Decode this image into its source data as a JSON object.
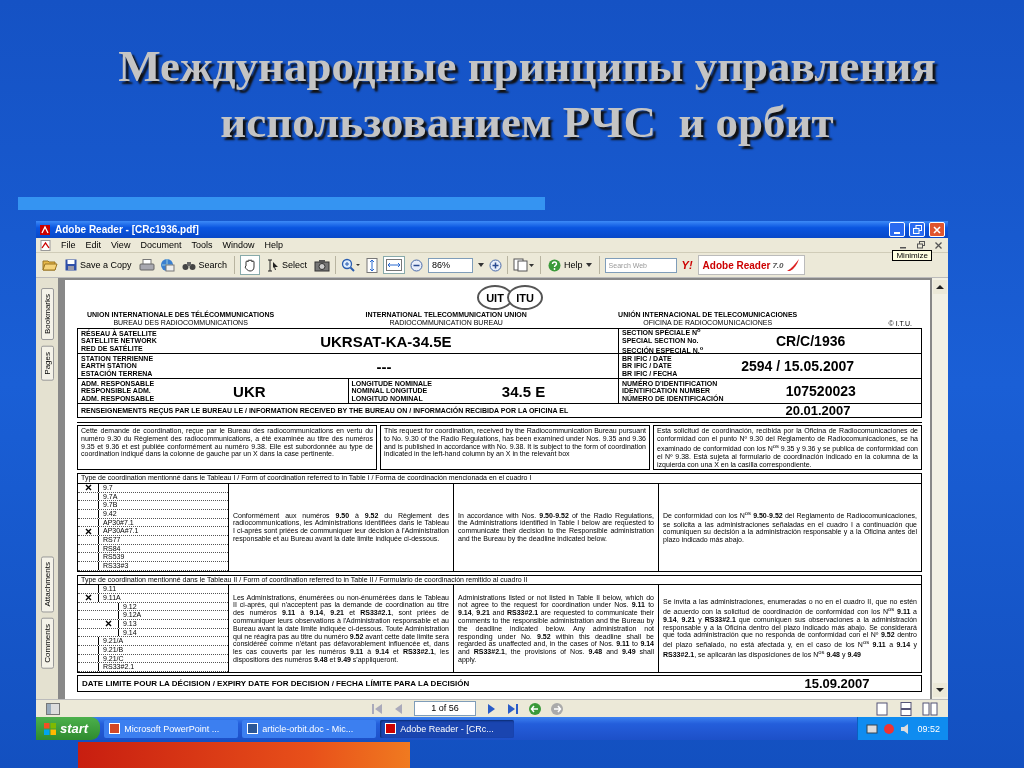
{
  "slide": {
    "title_lines": [
      "Международные принципы управления",
      "использованием РЧС  и орбит"
    ]
  },
  "window": {
    "title": "Adobe Reader - [CRc1936.pdf]",
    "tooltip": "Minimize"
  },
  "menu": [
    "File",
    "Edit",
    "View",
    "Document",
    "Tools",
    "Window",
    "Help"
  ],
  "toolbar": {
    "save_label": "Save a Copy",
    "search_label": "Search",
    "select_label": "Select",
    "zoom": "86%",
    "help_label": "Help",
    "search_web_placeholder": "Search Web",
    "yahoo": "Y!",
    "brand": "Adobe Reader",
    "version": "7.0"
  },
  "side_tabs": [
    {
      "label": "Bookmarks"
    },
    {
      "label": "Pages"
    },
    {
      "label": "Attachments"
    },
    {
      "label": "Comments"
    }
  ],
  "document": {
    "logo": [
      "UIT",
      "ITU"
    ],
    "orgs": [
      {
        "line1": "UNION INTERNATIONALE DES TÉLÉCOMMUNICATIONS",
        "line2": "BUREAU DES RADIOCOMMUNICATIONS"
      },
      {
        "line1": "INTERNATIONAL TELECOMMUNICATION UNION",
        "line2": "RADIOCOMMUNICATION BUREAU"
      },
      {
        "line1": "UNIÓN INTERNACIONAL DE TELECOMUNICACIONES",
        "line2": "OFICINA DE RADIOCOMUNICACIONES"
      }
    ],
    "copyright": "© I.T.U.",
    "network_rows": [
      {
        "cells": [
          {
            "labels": [
              "RÉSEAU À SATELLITE",
              "SATELLITE NETWORK",
              "RED DE SATÉLITE"
            ],
            "value": "UKRSAT-KA-34.5E"
          }
        ]
      },
      {
        "cells": [
          {
            "labels": [
              "STATION TERRIENNE",
              "EARTH STATION",
              "ESTACIÓN TERRENA"
            ],
            "value": "---"
          }
        ]
      },
      {
        "cells": [
          {
            "labels": [
              "ADM. RESPONSABLE",
              "RESPONSIBLE ADM.",
              "ADM. RESPONSABLE"
            ],
            "value": "UKR"
          },
          {
            "labels": [
              "LONGITUDE NOMINALE",
              "NOMINAL LONGITUDE",
              "LONGITUD NOMINAL"
            ],
            "value": "34.5 E"
          }
        ]
      }
    ],
    "reference_rows": [
      {
        "labels": [
          "SECTION SPÉCIALE N$^{o}$",
          "SPECIAL SECTION No.",
          "SECCIÓN ESPECIAL N.$^{o}$"
        ],
        "value": "CR/C/1936"
      },
      {
        "labels": [
          "BR IFIC / DATE",
          "BR IFIC / DATE",
          "BR IFIC / FECHA"
        ],
        "value": "2594 / 15.05.2007"
      },
      {
        "labels": [
          "NUMÉRO D'IDENTIFICATION",
          "IDENTIFICATION NUMBER",
          "NÚMERO DE IDENTIFICACIÓN"
        ],
        "value": "107520023"
      }
    ],
    "received": {
      "label": "RENSEIGNEMENTS REÇUS PAR LE BUREAU LE / INFORMATION RECEIVED BY THE BUREAU ON / INFORMACIÓN RECIBIDA POR LA OFICINA EL",
      "value": "20.01.2007"
    },
    "intro": [
      "Cette demande de coordination, reçue par le Bureau des radiocommunications en vertu du numéro 9.30 du Règlement des radiocommunications, a été examinée au titre des numéros 9.35 et 9.36 et est publiée conformément au numéro 9.38. Elle est subordonnée au type de coordination indiqué dans la colonne de gauche par un X dans la case pertinente.",
      "This request for coordination, received by the Radiocommunication Bureau pursuant to No. 9.30 of the Radio Regulations, has been examined under Nos. 9.35 and 9.36 and is published in accordance with No. 9.38. It is subject to the form of coordination indicated in the left-hand column by an X in the relevant box",
      "Esta solicitud de coordinación, recibida por la Oficina de Radiocomunicaciones de conformidad con el punto Nº 9.30 del Reglamento de Radiocomunicaciones, se ha examinado de conformidad con los N$^{os}$ 9.35 y 9.36 y se publica de conformidad con el Nº 9.38. Está sujeta al formulario de coordinación indicado en la columna de la izquierda con una X en la casilla correspondiente."
    ],
    "sections": [
      {
        "heading": "Type de coordination mentionné dans le Tableau I / Form of coordination referred to in Table I / Forma de coordinación mencionada en el cuadro I",
        "items": [
          {
            "label": "9.7",
            "checked": true
          },
          {
            "label": "9.7A",
            "checked": false
          },
          {
            "label": "9.7B",
            "checked": false
          },
          {
            "label": "9.42",
            "checked": false
          },
          {
            "label": "AP30#7.1",
            "checked": false
          },
          {
            "label": "AP30A#7.1",
            "checked": true
          },
          {
            "label": "RS77",
            "checked": false
          },
          {
            "label": "RS84",
            "checked": false
          },
          {
            "label": "RS539",
            "checked": false
          },
          {
            "label": "RS33#3",
            "checked": false
          }
        ],
        "texts": [
          "Conformément aux numéros **9.50** à **9.52** du Règlement des radiocommunications, les Administrations identifiées dans le Tableau I ci-après sont priées de communiquer leur décision à l'Administration responsable et au Bureau avant la date limite indiquée ci-dessous.",
          "In accordance with Nos. **9.50**-**9.52** of the Radio Regulations, the Administrations identified in Table I below are requested to communicate their decision to the Responsible administration and the Bureau by the deadline indicated below.",
          "De conformidad con los N$^{os}$ **9.50**-**9.52** del Reglamento de Radiocomunicaciones, se solicita a las administraciones señaladas en el cuadro I a continuación que comuniquen su decisión a la administración responsable y a la Oficina antes del plazo indicado más abajo."
        ]
      },
      {
        "heading": "Type de coordination mentionné dans le Tableau II / Form of coordination referred to in Table II / Formulario de coordinación remitido al cuadro II",
        "items": [
          {
            "label": "9.11",
            "checked": false
          },
          {
            "label": "9.11A",
            "checked": true,
            "children": [
              {
                "label": "9.12",
                "checked": false
              },
              {
                "label": "9.12A",
                "checked": false
              },
              {
                "label": "9.13",
                "checked": true
              },
              {
                "label": "9.14",
                "checked": false
              }
            ]
          },
          {
            "label": "9.21/A",
            "checked": false
          },
          {
            "label": "9.21/B",
            "checked": false
          },
          {
            "label": "9.21/C",
            "checked": false
          },
          {
            "label": "RS33#2.1",
            "checked": false
          }
        ],
        "texts": [
          "Les Administrations, énumérées ou non-énumérées dans le Tableau II ci-après, qui n'acceptent pas la demande de coordination au titre des numéros **9.11** à **9.14**, **9.21** et **RS33#2.1**, sont priées de communiquer leurs observations à l'Administration responsable et au Bureau avant la date limite indiquée ci-dessous. Toute Administration qui ne réagira pas au titre du numéro **9.52** avant cette date limite sera considérée comme n'étant pas défavorablement influencée et, dans les cas couverts par les numéros **9.11** à **9.14** et **RS33#2.1**, les dispositions des numéros **9.48** et **9.49** s'appliqueront.",
          "Administrations listed or not listed in Table II below, which do not agree to the request for coordination under Nos. **9.11** to **9.14**, **9.21** and **RS33#2.1** are requested to communicate their comments to the responsible administration and the Bureau by the deadline indicated below. Any administration not responding under No. **9.52** within this deadline shall be regarded as unaffected and, in the cases of Nos. **9.11** to **9.14** and **RS33#2.1**, the provisions of Nos. **9.48** and **9.49** shall apply.",
          "Se invita a las administraciones, enumeradas o no en el cuadro II, que no estén de acuerdo con la solicitud de coordinación de conformidad con los N$^{os}$ **9.11** a **9.14**, **9.21** y **RS33#2.1** que comuniquen sus observaciones a la administración responsable y a la Oficina dentro del plazo indicado más abajo. Se considerará que toda administración que no responda de conformidad con el Nº **9.52** dentro del plazo señalado, no está afectada y, en el caso de los N$^{os}$ **9.11** a **9.14** y **RS33#2.1**, se aplicarán las disposiciones de los N$^{os}$ **9.48** y **9.49**"
        ]
      }
    ],
    "deadline": {
      "label": "DATE LIMITE POUR LA DÉCISION / EXPIRY DATE FOR DECISION / FECHA LÍMITE PARA LA DECISIÓN",
      "value": "15.09.2007"
    }
  },
  "nav": {
    "page": "1 of 56"
  },
  "taskbar": {
    "start": "start",
    "tasks": [
      {
        "label": "Microsoft PowerPoint ...",
        "selected": false
      },
      {
        "label": "article-orbit.doc - Mic...",
        "selected": false
      },
      {
        "label": "Adobe Reader - [CRc...",
        "selected": true
      }
    ],
    "clock": "09:52"
  }
}
